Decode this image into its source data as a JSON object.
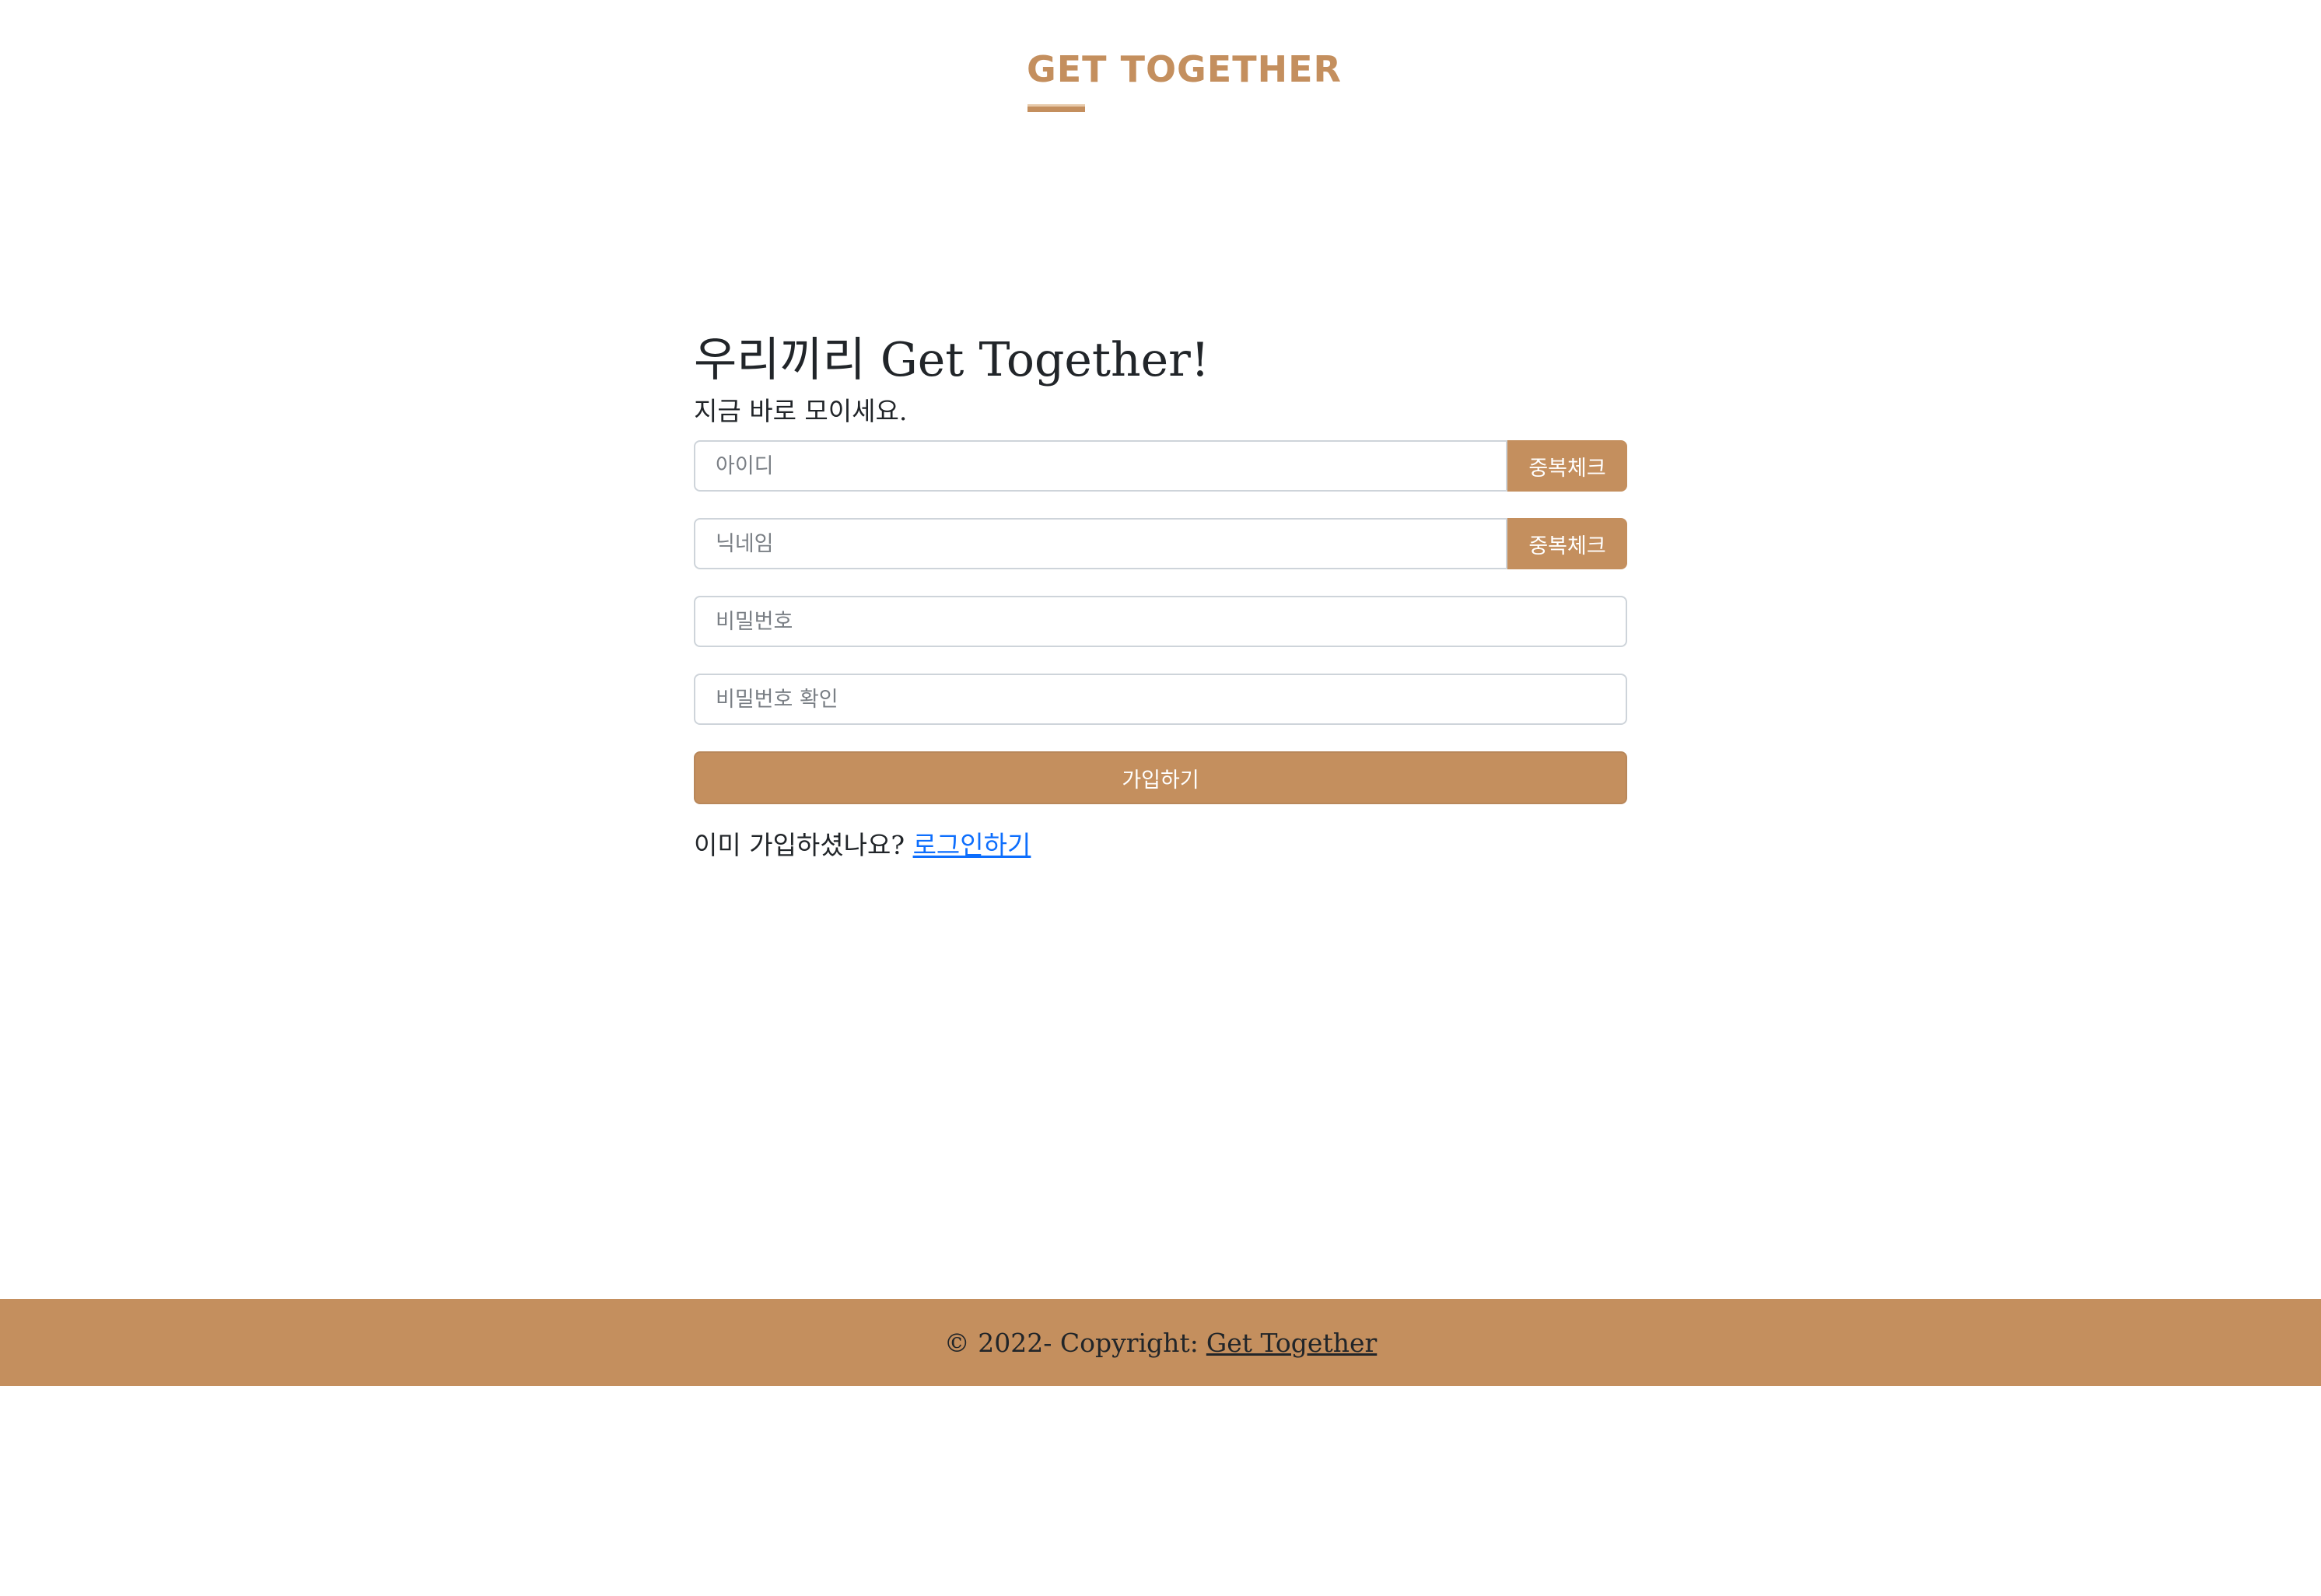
{
  "header": {
    "brand": "GET TOGETHER"
  },
  "main": {
    "title": "우리끼리 Get Together!",
    "subtitle": "지금 바로 모이세요.",
    "fields": {
      "id_placeholder": "아이디",
      "nickname_placeholder": "닉네임",
      "password_placeholder": "비밀번호",
      "password_confirm_placeholder": "비밀번호 확인"
    },
    "check_label": "중복체크",
    "submit_label": "가입하기",
    "login_prompt": "이미 가입하셨나요?",
    "login_link": "로그인하기"
  },
  "footer": {
    "copyright": "© 2022- Copyright:",
    "link": "Get Together"
  },
  "colors": {
    "accent": "#c48f5e",
    "link": "#0d6efd"
  }
}
